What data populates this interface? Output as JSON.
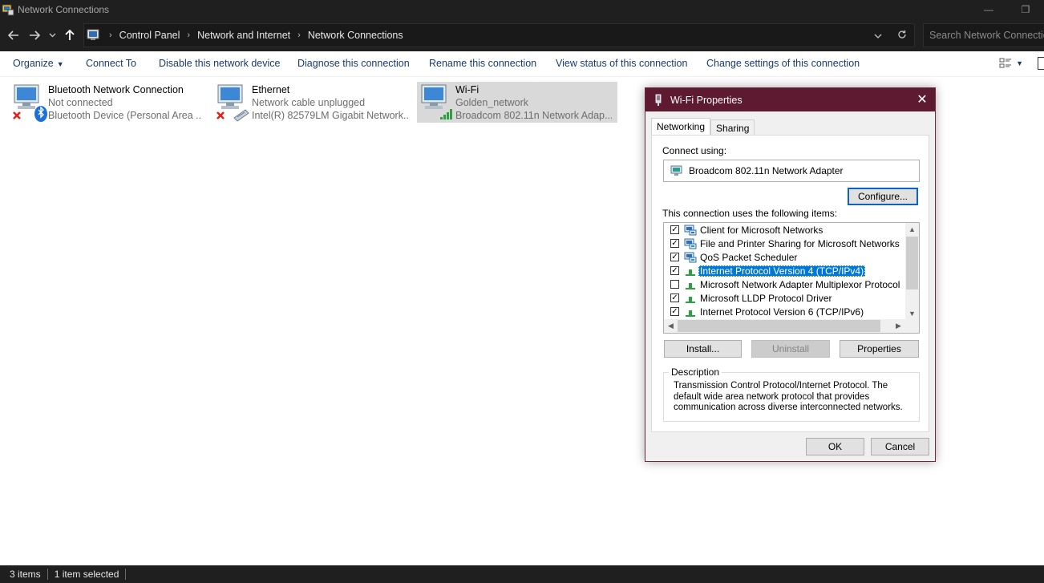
{
  "window": {
    "title": "Network Connections"
  },
  "address": {
    "crumbs": [
      "Control Panel",
      "Network and Internet",
      "Network Connections"
    ],
    "search_placeholder": "Search Network Connections"
  },
  "commands": {
    "organize": "Organize",
    "connect_to": "Connect To",
    "disable": "Disable this network device",
    "diagnose": "Diagnose this connection",
    "rename": "Rename this connection",
    "view_status": "View status of this connection",
    "change_settings": "Change settings of this connection"
  },
  "connections": [
    {
      "name": "Bluetooth Network Connection",
      "status": "Not connected",
      "device": "Bluetooth Device (Personal Area ..."
    },
    {
      "name": "Ethernet",
      "status": "Network cable unplugged",
      "device": "Intel(R) 82579LM Gigabit Network..."
    },
    {
      "name": "Wi-Fi",
      "status": "Golden_network",
      "device": "Broadcom 802.11n Network Adap..."
    }
  ],
  "statusbar": {
    "items_count": "3 items",
    "selected": "1 item selected"
  },
  "dialog": {
    "title": "Wi-Fi Properties",
    "tabs": [
      "Networking",
      "Sharing"
    ],
    "connect_using_label": "Connect using:",
    "adapter": "Broadcom 802.11n Network Adapter",
    "configure_label": "Configure...",
    "items_label": "This connection uses the following items:",
    "items": [
      {
        "label": "Client for Microsoft Networks",
        "checked": true,
        "icon": "network-client-icon"
      },
      {
        "label": "File and Printer Sharing for Microsoft Networks",
        "checked": true,
        "icon": "network-service-icon"
      },
      {
        "label": "QoS Packet Scheduler",
        "checked": true,
        "icon": "network-service-icon"
      },
      {
        "label": "Internet Protocol Version 4 (TCP/IPv4)",
        "checked": true,
        "icon": "protocol-icon",
        "selected": true
      },
      {
        "label": "Microsoft Network Adapter Multiplexor Protocol",
        "checked": false,
        "icon": "protocol-icon"
      },
      {
        "label": "Microsoft LLDP Protocol Driver",
        "checked": true,
        "icon": "protocol-icon"
      },
      {
        "label": "Internet Protocol Version 6 (TCP/IPv6)",
        "checked": true,
        "icon": "protocol-icon"
      }
    ],
    "install_label": "Install...",
    "uninstall_label": "Uninstall",
    "properties_label": "Properties",
    "description_legend": "Description",
    "description_text": "Transmission Control Protocol/Internet Protocol. The default wide area network protocol that provides communication across diverse interconnected networks.",
    "ok_label": "OK",
    "cancel_label": "Cancel"
  },
  "colors": {
    "accent": "#0078d7",
    "dialog_title": "#5e1a30",
    "dark_chrome": "#1f1f1f"
  }
}
